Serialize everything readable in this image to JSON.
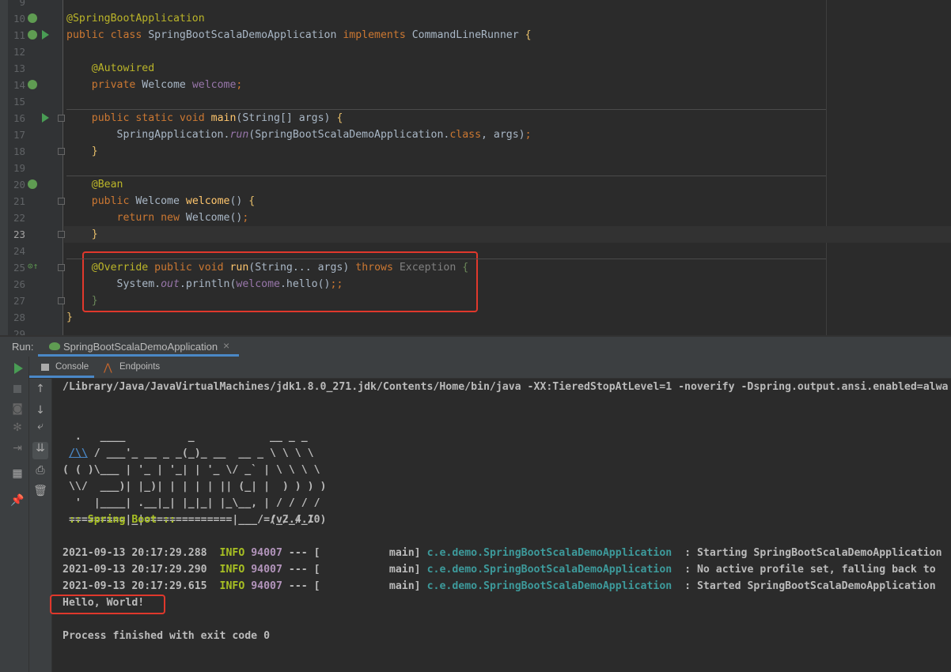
{
  "editor": {
    "current_line": 23,
    "lines": [
      {
        "n": 9,
        "tokens": []
      },
      {
        "n": 10,
        "tokens": [
          [
            "@SpringBootApplication",
            "an"
          ]
        ]
      },
      {
        "n": 11,
        "tokens": [
          [
            "public class ",
            "kw"
          ],
          [
            "SpringBootScalaDemoApplication ",
            ""
          ],
          [
            "implements ",
            "kw"
          ],
          [
            "CommandLineRunner ",
            ""
          ],
          [
            "{",
            "br"
          ]
        ]
      },
      {
        "n": 12,
        "tokens": []
      },
      {
        "n": 13,
        "tokens": [
          [
            "    ",
            ""
          ],
          [
            "@Autowired",
            "an"
          ]
        ]
      },
      {
        "n": 14,
        "tokens": [
          [
            "    ",
            ""
          ],
          [
            "private ",
            "kw"
          ],
          [
            "Welcome ",
            ""
          ],
          [
            "welcome",
            "fd"
          ],
          [
            ";",
            "kw"
          ]
        ]
      },
      {
        "n": 15,
        "tokens": []
      },
      {
        "n": 16,
        "tokens": [
          [
            "    ",
            ""
          ],
          [
            "public static void ",
            "kw"
          ],
          [
            "main",
            "fn"
          ],
          [
            "(String[] args) ",
            ""
          ],
          [
            "{",
            "br"
          ]
        ]
      },
      {
        "n": 17,
        "tokens": [
          [
            "        SpringApplication.",
            ""
          ],
          [
            "run",
            "it"
          ],
          [
            "(SpringBootScalaDemoApplication.",
            ""
          ],
          [
            "class",
            "kw"
          ],
          [
            ", args)",
            ""
          ],
          [
            ";",
            "kw"
          ]
        ]
      },
      {
        "n": 18,
        "tokens": [
          [
            "    ",
            ""
          ],
          [
            "}",
            "br"
          ]
        ]
      },
      {
        "n": 19,
        "tokens": []
      },
      {
        "n": 20,
        "tokens": [
          [
            "    ",
            ""
          ],
          [
            "@Bean",
            "an"
          ]
        ]
      },
      {
        "n": 21,
        "tokens": [
          [
            "    ",
            ""
          ],
          [
            "public ",
            "kw"
          ],
          [
            "Welcome ",
            ""
          ],
          [
            "welcome",
            "fn"
          ],
          [
            "() ",
            ""
          ],
          [
            "{",
            "br"
          ]
        ]
      },
      {
        "n": 22,
        "tokens": [
          [
            "        ",
            ""
          ],
          [
            "return new ",
            "kw"
          ],
          [
            "Welcome()",
            ""
          ],
          [
            ";",
            "kw"
          ]
        ]
      },
      {
        "n": 23,
        "tokens": [
          [
            "    ",
            ""
          ],
          [
            "}",
            "br"
          ]
        ]
      },
      {
        "n": 24,
        "tokens": []
      },
      {
        "n": 25,
        "tokens": [
          [
            "    ",
            ""
          ],
          [
            "@Override ",
            "an"
          ],
          [
            "public void ",
            "kw"
          ],
          [
            "run",
            "fn"
          ],
          [
            "(String... args) ",
            ""
          ],
          [
            "throws ",
            "kw"
          ],
          [
            "Exception ",
            "gr"
          ],
          [
            "{",
            "gb"
          ]
        ]
      },
      {
        "n": 26,
        "tokens": [
          [
            "        System.",
            ""
          ],
          [
            "out",
            "it"
          ],
          [
            ".println(",
            ""
          ],
          [
            "welcome",
            "fd"
          ],
          [
            ".hello()",
            ""
          ],
          [
            ";;",
            "kw"
          ]
        ]
      },
      {
        "n": 27,
        "tokens": [
          [
            "    ",
            ""
          ],
          [
            "}",
            "gb"
          ]
        ]
      },
      {
        "n": 28,
        "tokens": [
          [
            "}",
            "br"
          ]
        ]
      },
      {
        "n": 29,
        "tokens": []
      }
    ]
  },
  "run_panel": {
    "label": "Run:",
    "config_name": "SpringBootScalaDemoApplication",
    "close": "×",
    "tabs": [
      {
        "label": "Console",
        "active": true
      },
      {
        "label": "Endpoints",
        "active": false
      }
    ],
    "left_toolbar": [
      "run-icon",
      "stop-icon",
      "camera-icon",
      "debug-icon",
      "login-icon",
      "layout-icon",
      "pin-icon"
    ],
    "console_toolbar": [
      "up-icon",
      "down-icon",
      "wrap-icon",
      "scroll-end-icon",
      "print-icon",
      "trash-icon"
    ]
  },
  "console": {
    "command": "/Library/Java/JavaVirtualMachines/jdk1.8.0_271.jdk/Contents/Home/bin/java -XX:TieredStopAtLevel=1 -noverify -Dspring.output.ansi.enabled=alwa",
    "banner": [
      "  .   ____          _            __ _ _",
      [
        " ",
        "/\\\\",
        " / ___'_ __ _ _(_)_ __  __ _ \\ \\ \\ \\"
      ],
      "( ( )\\___ | '_ | '_| | '_ \\/ _` | \\ \\ \\ \\",
      " \\\\/  ___)| |_)| | | | | || (_| |  ) ) ) )",
      "  '  |____| .__|_| |_|_| |_\\__, | / / / /",
      " =========|_|==============|___/=/_/_/_/"
    ],
    "spring_boot_label": " :: Spring Boot :: ",
    "spring_boot_version": "              (v2.4.10)",
    "logs": [
      {
        "ts": "2021-09-13 20:17:29.288",
        "level": "INFO",
        "pid": "94007",
        "thread": " --- [           main] ",
        "logger": "c.e.demo.SpringBootScalaDemoApplication",
        "msg": "  : Starting SpringBootScalaDemoApplication"
      },
      {
        "ts": "2021-09-13 20:17:29.290",
        "level": "INFO",
        "pid": "94007",
        "thread": " --- [           main] ",
        "logger": "c.e.demo.SpringBootScalaDemoApplication",
        "msg": "  : No active profile set, falling back to"
      },
      {
        "ts": "2021-09-13 20:17:29.615",
        "level": "INFO",
        "pid": "94007",
        "thread": " --- [           main] ",
        "logger": "c.e.demo.SpringBootScalaDemoApplication",
        "msg": "  : Started SpringBootScalaDemoApplication"
      }
    ],
    "output": "Hello, World!",
    "exit_message": "Process finished with exit code 0"
  },
  "colors": {
    "highlight_box": "#e0382c",
    "background": "#2b2b2b",
    "keyword": "#cc7832",
    "annotation": "#bbb529"
  }
}
